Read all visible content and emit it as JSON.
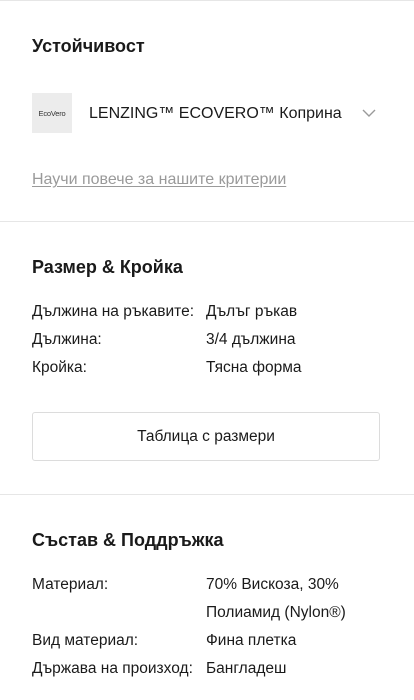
{
  "sustainability": {
    "title": "Устойчивост",
    "certificate": {
      "logo_text": "EcoVero",
      "label": "LENZING™ ECOVERO™ Коприна",
      "icon": "chevron-down-icon"
    },
    "learn_more_link": "Научи повече за нашите критерии"
  },
  "size_fit": {
    "title": "Размер & Кройка",
    "rows": [
      {
        "label": "Дължина на ръкавите:",
        "value": "Дълъг ръкав"
      },
      {
        "label": "Дължина:",
        "value": "3/4 дължина"
      },
      {
        "label": "Кройка:",
        "value": "Тясна форма"
      }
    ],
    "size_chart_button": "Таблица с размери"
  },
  "composition_care": {
    "title": "Състав & Поддръжка",
    "rows": [
      {
        "label": "Материал:",
        "value_lines": [
          "70% Вискоза, 30%",
          "Полиамид (Nylon®)"
        ]
      },
      {
        "label": "Вид материал:",
        "value": "Фина плетка"
      },
      {
        "label": "Държава на произход:",
        "value": "Бангладеш"
      }
    ]
  },
  "colors": {
    "text": "#1a1a1a",
    "muted_link": "#9a9a9a",
    "divider": "#e6e6e6",
    "logo_bg": "#ececec"
  }
}
